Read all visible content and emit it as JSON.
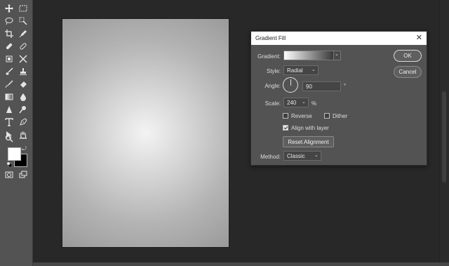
{
  "dialog": {
    "title": "Gradient Fill",
    "gradient_label": "Gradient:",
    "style_label": "Style:",
    "style_value": "Radial",
    "angle_label": "Angle:",
    "angle_value": "90",
    "angle_unit": "°",
    "scale_label": "Scale:",
    "scale_value": "240",
    "scale_unit": "%",
    "reverse_label": "Reverse",
    "reverse_checked": false,
    "dither_label": "Dither",
    "dither_checked": false,
    "align_label": "Align with layer",
    "align_checked": true,
    "reset_label": "Reset Alignment",
    "method_label": "Method:",
    "method_value": "Classic",
    "ok_label": "OK",
    "cancel_label": "Cancel",
    "close_glyph": "✕"
  },
  "colors": {
    "foreground": "#ffffff",
    "background": "#000000",
    "gradient_start": "#ffffff",
    "gradient_end": "#3a3a3a"
  },
  "toolbar": {
    "tools": [
      "move-icon",
      "marquee-icon",
      "lasso-icon",
      "quick-select-icon",
      "crop-icon",
      "eyedropper-icon",
      "healing-icon",
      "bandaid-icon",
      "patch-icon",
      "content-aware-move-icon",
      "brush-icon",
      "stamp-icon",
      "history-brush-icon",
      "eraser-icon",
      "gradient-icon",
      "blur-icon",
      "sharpen-icon",
      "dodge-icon",
      "type-icon",
      "pen-icon",
      "path-select-icon",
      "hand-icon",
      "zoom-icon",
      "more-icon",
      "quick-mask-icon",
      "screen-mode-icon"
    ]
  }
}
